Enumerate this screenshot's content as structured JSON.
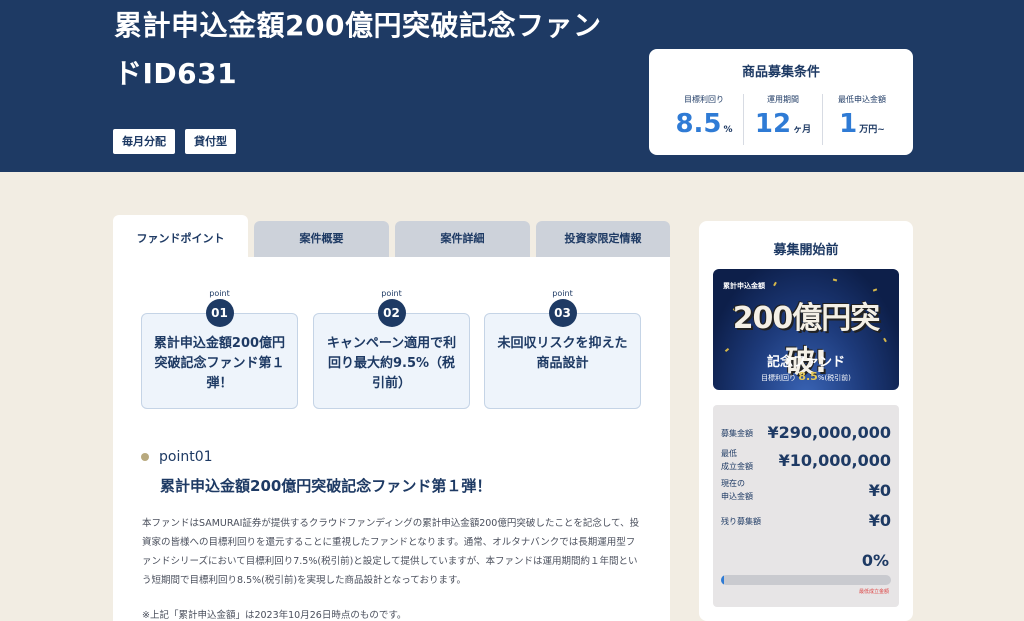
{
  "hero": {
    "title": "累計申込金額200億円突破記念ファンドID631",
    "tags": [
      "毎月分配",
      "貸付型"
    ]
  },
  "conditions": {
    "title": "商品募集条件",
    "items": [
      {
        "label": "目標利回り",
        "value": "8.5",
        "unit": "%"
      },
      {
        "label": "運用期間",
        "value": "12",
        "unit": "ヶ月"
      },
      {
        "label": "最低申込金額",
        "value": "1",
        "unit": "万円~"
      }
    ]
  },
  "tabs": [
    "ファンドポイント",
    "案件概要",
    "案件詳細",
    "投資家限定情報"
  ],
  "points": [
    {
      "label": "point",
      "num": "01",
      "text": "累計申込金額200億円突破記念ファンド第１弾！"
    },
    {
      "label": "point",
      "num": "02",
      "text": "キャンペーン適用で利回り最大約9.5%（税引前）"
    },
    {
      "label": "point",
      "num": "03",
      "text": "未回収リスクを抑えた商品設計"
    }
  ],
  "section": {
    "kicker": "point01",
    "title": "累計申込金額200億円突破記念ファンド第１弾！",
    "body": "本ファンドはSAMURAI証券が提供するクラウドファンディングの累計申込金額200億円突破したことを記念して、投資家の皆様への目標利回りを還元することに重視したファンドとなります。通常、オルタナバンクでは長期運用型ファンドシリーズにおいて目標利回り7.5%(税引前)と設定して提供していますが、本ファンドは運用期間約１年間という短期間で目標利回り8.5%(税引前)を実現した商品設計となっております。",
    "note": "※上記「累計申込金額」は2023年10月26日時点のものです。"
  },
  "side": {
    "title": "募集開始前",
    "banner": {
      "small": "累計申込金額",
      "big": "200億円突破!",
      "sub": "記念ファンド",
      "rate_prefix": "目標利回り",
      "rate_value": "8.5",
      "rate_suffix": "%(税引前)"
    },
    "stats": [
      {
        "key": "募集金額",
        "value": "¥290,000,000"
      },
      {
        "key": "最低\n成立金額",
        "value": "¥10,000,000"
      },
      {
        "key": "現在の\n申込金額",
        "value": "¥0"
      },
      {
        "key": "残り募集額",
        "value": "¥0"
      }
    ],
    "percent": "0%",
    "progress": 0.02,
    "bar_note": "最低成立金額"
  },
  "colors": {
    "navy": "#1e3a64",
    "accent": "#2f7bd5",
    "gold": "#e3c75a"
  }
}
